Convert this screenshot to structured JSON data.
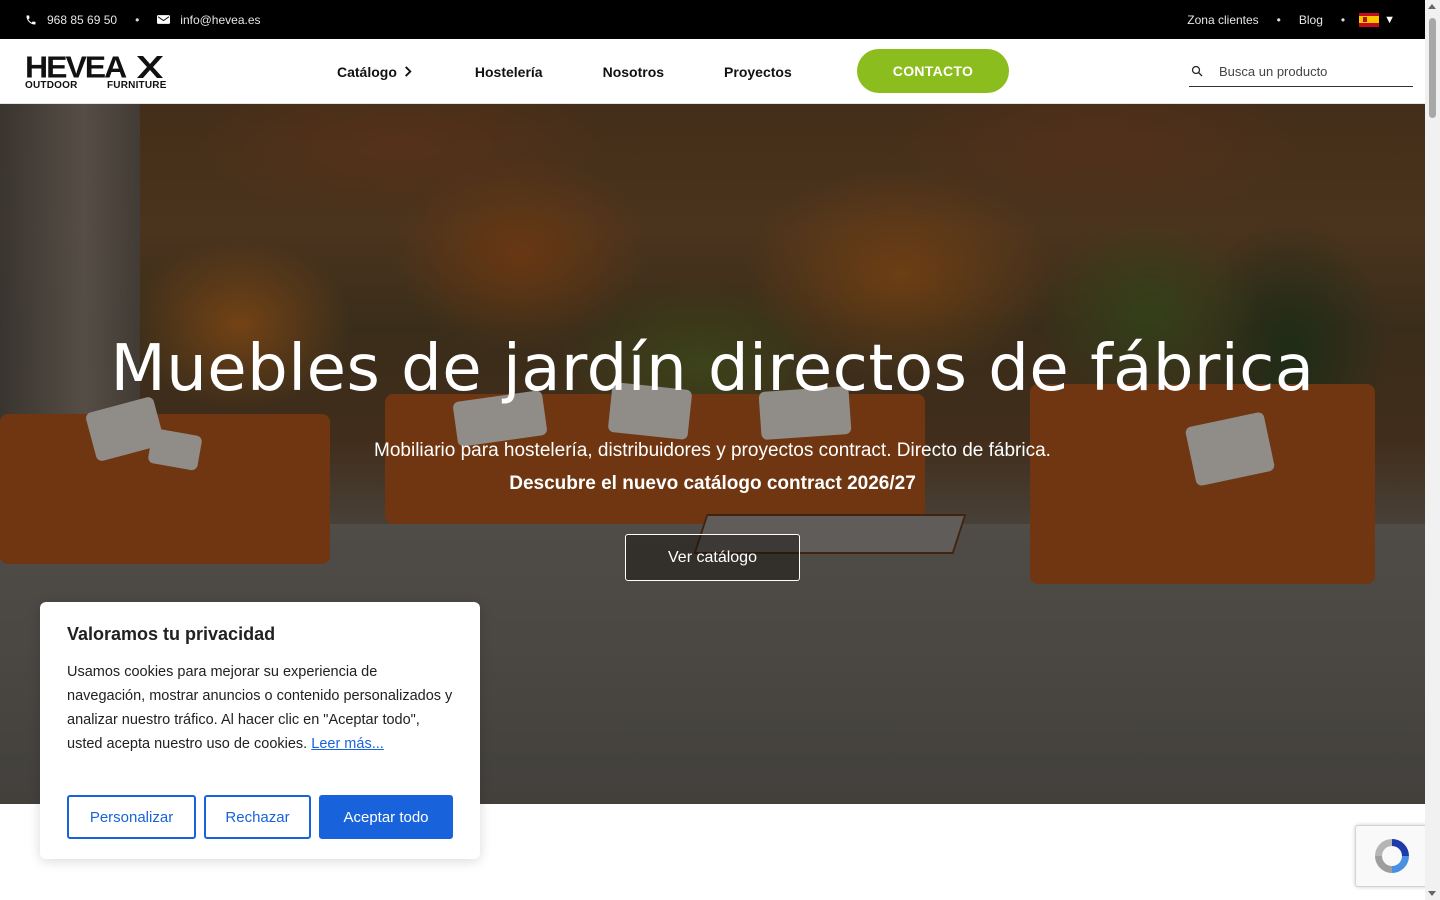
{
  "topbar": {
    "phone": "968 85 69 50",
    "email": "info@hevea.es",
    "zona_clientes": "Zona clientes",
    "blog": "Blog",
    "separator": "•",
    "language_caret": "▼"
  },
  "logo": {
    "word": "HEVEA",
    "left_sub": "OUTDOOR",
    "right_sub": "FURNITURE"
  },
  "nav": {
    "catalogo": "Catálogo",
    "hosteleria": "Hostelería",
    "nosotros": "Nosotros",
    "proyectos": "Proyectos",
    "contacto": "CONTACTO"
  },
  "search": {
    "placeholder": "Busca un producto"
  },
  "hero": {
    "title": "Muebles de jardín directos de fábrica",
    "subtitle": "Mobiliario para hostelería, distribuidores y proyectos contract. Directo de fábrica.",
    "highlight": "Descubre el nuevo catálogo contract 2026/27",
    "button": "Ver catálogo"
  },
  "cookie": {
    "title": "Valoramos tu privacidad",
    "body": "Usamos cookies para mejorar su experiencia de navegación, mostrar anuncios o contenido personalizados y analizar nuestro tráfico. Al hacer clic en \"Aceptar todo\", usted acepta nuestro uso de cookies.",
    "read_more": "Leer más...",
    "customize": "Personalizar",
    "reject": "Rechazar",
    "accept": "Aceptar todo"
  },
  "colors": {
    "brand_green": "#8cbd1f",
    "cookie_blue": "#1863dc",
    "topbar": "#000000"
  }
}
